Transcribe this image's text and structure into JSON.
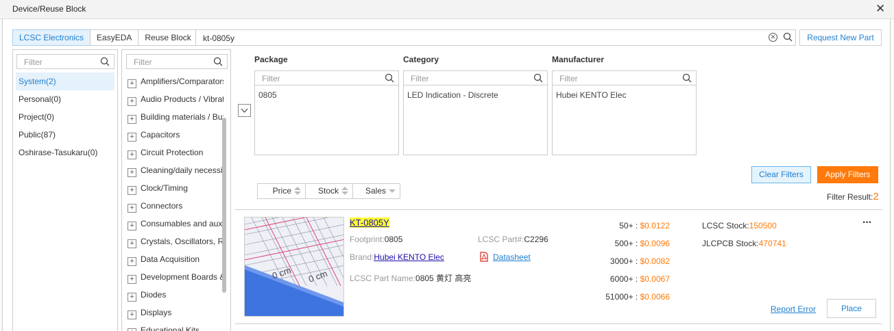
{
  "window": {
    "title": "Device/Reuse Block"
  },
  "tabs": [
    "LCSC Electronics",
    "EasyEDA",
    "Reuse Block"
  ],
  "search": {
    "value": "kt-0805y"
  },
  "request_button": "Request New Part",
  "libraries": {
    "filter_placeholder": "Filter",
    "items": [
      "System(2)",
      "Personal(0)",
      "Project(0)",
      "Public(87)",
      "Oshirase-Tasukaru(0)"
    ]
  },
  "categories": {
    "filter_placeholder": "Filter",
    "items": [
      "Amplifiers/Comparators",
      "Audio Products / Vibration",
      "Building materials / Buzzers",
      "Capacitors",
      "Circuit Protection",
      "Cleaning/daily necessities",
      "Clock/Timing",
      "Connectors",
      "Consumables and auxiliary",
      "Crystals, Oscillators, Resonators",
      "Data Acquisition",
      "Development Boards & Kits",
      "Diodes",
      "Displays",
      "Educational Kits"
    ]
  },
  "filters": {
    "package": {
      "label": "Package",
      "placeholder": "Filter",
      "options": [
        "0805"
      ]
    },
    "category": {
      "label": "Category",
      "placeholder": "Filter",
      "options": [
        "LED Indication - Discrete"
      ]
    },
    "manufacturer": {
      "label": "Manufacturer",
      "placeholder": "Filter",
      "options": [
        "Hubei KENTO Elec"
      ]
    }
  },
  "buttons": {
    "clear": "Clear Filters",
    "apply": "Apply Filters",
    "report": "Report Error",
    "place": "Place"
  },
  "sort": [
    "Price",
    "Stock",
    "Sales"
  ],
  "result": {
    "label": "Filter Result:",
    "count": "2"
  },
  "part": {
    "name": "KT-0805Y",
    "footprint_label": "Footprint:",
    "footprint": "0805",
    "lcsc_part_label": "LCSC Part#:",
    "lcsc_part": "C2296",
    "brand_label": "Brand:",
    "brand": "Hubei KENTO Elec",
    "datasheet": "Datasheet",
    "part_name_label": "LCSC Part Name:",
    "part_name": "0805 黄灯 高亮",
    "prices": [
      {
        "qty": "50+ : ",
        "price": "$0.0122"
      },
      {
        "qty": "500+ : ",
        "price": "$0.0096"
      },
      {
        "qty": "3000+ : ",
        "price": "$0.0082"
      },
      {
        "qty": "6000+ : ",
        "price": "$0.0067"
      },
      {
        "qty": "51000+ : ",
        "price": "$0.0066"
      }
    ],
    "lcsc_stock_label": "LCSC Stock:",
    "lcsc_stock": "150500",
    "jlcpcb_stock_label": "JLCPCB Stock:",
    "jlcpcb_stock": "470741",
    "more": "···"
  },
  "colors": {
    "accent": "#1e7fd0",
    "orange": "#ff7a0a",
    "highlight": "#ffff33"
  }
}
